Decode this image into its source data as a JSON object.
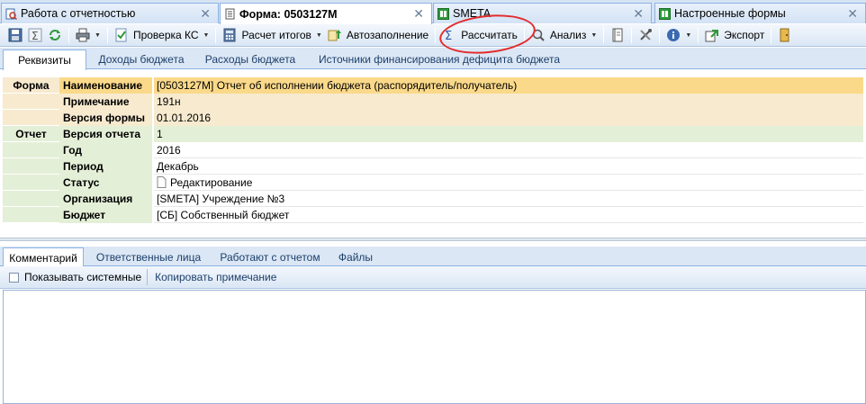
{
  "doc_tabs": [
    {
      "label": "Работа с отчетностью",
      "icon": "report-search-icon",
      "active": false
    },
    {
      "label": "Форма: 0503127М",
      "icon": "form-document-icon",
      "active": true
    },
    {
      "label": "SMETA",
      "icon": "smeta-grid-icon",
      "active": false
    },
    {
      "label": "Настроенные формы",
      "icon": "smeta-grid-icon",
      "active": false
    }
  ],
  "toolbar": {
    "check_ks": "Проверка КС",
    "calc_totals": "Расчет итогов",
    "autofill": "Автозаполнение",
    "calculate": "Рассчитать",
    "analysis": "Анализ",
    "export": "Экспорт"
  },
  "form_tabs": [
    "Реквизиты",
    "Доходы бюджета",
    "Расходы бюджета",
    "Источники финансирования дефицита бюджета"
  ],
  "properties": {
    "form_category": "Форма",
    "report_category": "Отчет",
    "rows": [
      {
        "name": "Наименование",
        "value": "[0503127М] Отчет об исполнении бюджета (распорядитель/получатель)"
      },
      {
        "name": "Примечание",
        "value": "191н"
      },
      {
        "name": "Версия формы",
        "value": "01.01.2016"
      },
      {
        "name": "Версия отчета",
        "value": "1"
      },
      {
        "name": "Год",
        "value": "2016"
      },
      {
        "name": "Период",
        "value": "Декабрь"
      },
      {
        "name": "Статус",
        "value": "Редактирование"
      },
      {
        "name": "Организация",
        "value": "[SMETA] Учреждение №3"
      },
      {
        "name": "Бюджет",
        "value": "[СБ] Собственный бюджет"
      }
    ]
  },
  "bottom_tabs": [
    "Комментарий",
    "Ответственные лица",
    "Работают с отчетом",
    "Файлы"
  ],
  "bottom_bar": {
    "show_system": "Показывать системные",
    "copy_note": "Копировать примечание"
  },
  "colors": {
    "form_section_bg": "#f7eacf",
    "report_section_bg": "#e4efd7",
    "selected_row_bg": "#fbd98a",
    "annotation": "#e32b2b"
  }
}
